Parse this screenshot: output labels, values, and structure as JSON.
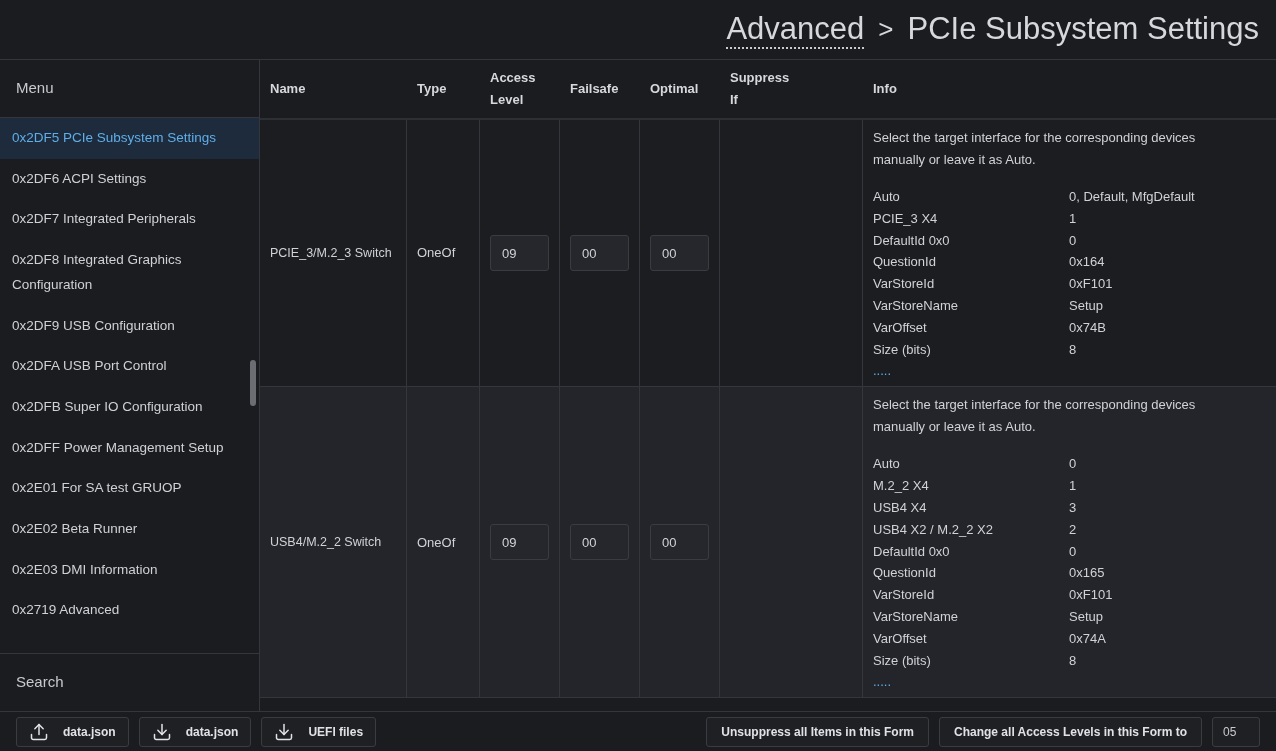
{
  "breadcrumb": {
    "parent": "Advanced",
    "separator": ">",
    "current": "PCIe Subsystem Settings"
  },
  "sidebar": {
    "title": "Menu",
    "items": [
      {
        "label": "0x2DF5 PCIe Subsystem Settings",
        "selected": true
      },
      {
        "label": "0x2DF6 ACPI Settings",
        "selected": false
      },
      {
        "label": "0x2DF7 Integrated Peripherals",
        "selected": false
      },
      {
        "label": "0x2DF8 Integrated Graphics Configuration",
        "selected": false
      },
      {
        "label": "0x2DF9 USB Configuration",
        "selected": false
      },
      {
        "label": "0x2DFA USB Port Control",
        "selected": false
      },
      {
        "label": "0x2DFB Super IO Configuration",
        "selected": false
      },
      {
        "label": "0x2DFF Power Management Setup",
        "selected": false
      },
      {
        "label": "0x2E01 For SA test GRUOP",
        "selected": false
      },
      {
        "label": "0x2E02 Beta Runner",
        "selected": false
      },
      {
        "label": "0x2E03 DMI Information",
        "selected": false
      },
      {
        "label": "0x2719 Advanced",
        "selected": false
      }
    ],
    "search_label": "Search"
  },
  "table": {
    "columns": [
      "Name",
      "Type",
      "Access Level",
      "Failsafe",
      "Optimal",
      "Suppress If",
      "Info"
    ],
    "rows": [
      {
        "name": "PCIE_3/M.2_3 Switch",
        "type": "OneOf",
        "access_level": "09",
        "failsafe": "00",
        "optimal": "00",
        "info": "Select the target interface for the corresponding devices manually or leave it as Auto.",
        "details": [
          [
            "Auto",
            "0, Default, MfgDefault"
          ],
          [
            "PCIE_3 X4",
            "1"
          ],
          [
            "DefaultId 0x0",
            "0"
          ],
          [
            "QuestionId",
            "0x164"
          ],
          [
            "VarStoreId",
            "0xF101"
          ],
          [
            "VarStoreName",
            "Setup"
          ],
          [
            "VarOffset",
            "0x74B"
          ],
          [
            "Size (bits)",
            "8"
          ]
        ],
        "more": "....."
      },
      {
        "name": "USB4/M.2_2 Switch",
        "type": "OneOf",
        "access_level": "09",
        "failsafe": "00",
        "optimal": "00",
        "info": "Select the target interface for the corresponding devices manually or leave it as Auto.",
        "details": [
          [
            "Auto",
            "0"
          ],
          [
            "M.2_2 X4",
            "1"
          ],
          [
            "USB4 X4",
            "3"
          ],
          [
            "USB4 X2 / M.2_2 X2",
            "2"
          ],
          [
            "DefaultId 0x0",
            "0"
          ],
          [
            "QuestionId",
            "0x165"
          ],
          [
            "VarStoreId",
            "0xF101"
          ],
          [
            "VarStoreName",
            "Setup"
          ],
          [
            "VarOffset",
            "0x74A"
          ],
          [
            "Size (bits)",
            "8"
          ]
        ],
        "more": "....."
      }
    ]
  },
  "footer": {
    "buttons": [
      {
        "kind": "upload",
        "label": "data.json"
      },
      {
        "kind": "download",
        "label": "data.json"
      },
      {
        "kind": "download",
        "label": "UEFI files"
      }
    ],
    "unsuppress": "Unsuppress all Items in this Form",
    "change_access": "Change all Access Levels in this Form to",
    "access_value": "05"
  }
}
